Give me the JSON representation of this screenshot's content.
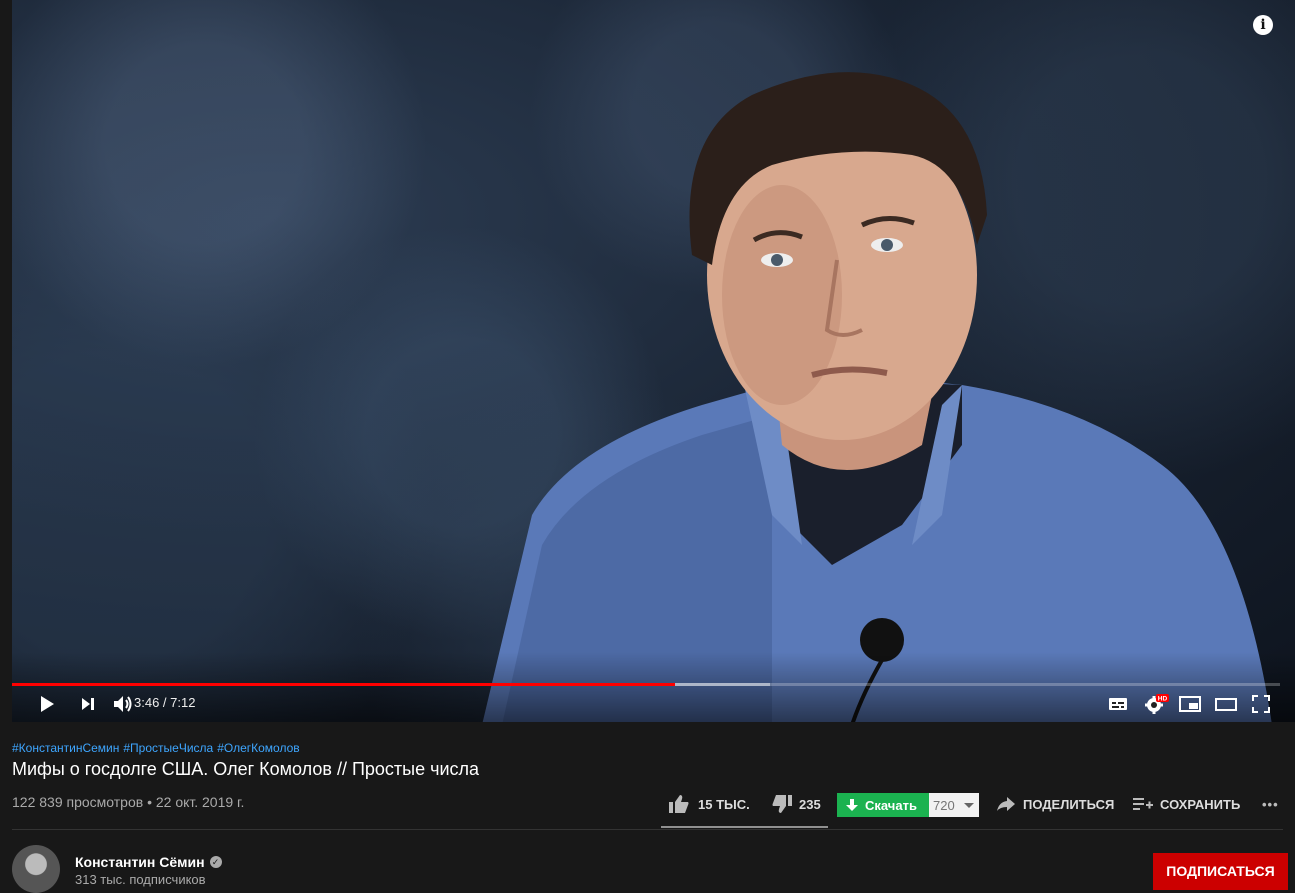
{
  "player": {
    "current_time": "3:46",
    "duration": "7:12",
    "time_display": "3:46 / 7:12",
    "progress_played_fraction": 0.523,
    "progress_buffered_fraction": 0.598,
    "hd_badge": "HD"
  },
  "video": {
    "hashtags": [
      "#КонстантинСемин",
      "#ПростыеЧисла",
      "#ОлегКомолов"
    ],
    "title": "Мифы о госдолге США. Олег Комолов // Простые числа",
    "meta": "122 839 просмотров • 22 окт. 2019 г."
  },
  "actions": {
    "likes": "15 ТЫС.",
    "dislikes": "235",
    "like_fraction": 0.985,
    "download_label": "Скачать",
    "download_quality": "720",
    "share_label": "ПОДЕЛИТЬСЯ",
    "save_label": "СОХРАНИТЬ",
    "more_label": "•••"
  },
  "channel": {
    "name": "Константин Сёмин",
    "subscribers": "313 тыс. подписчиков",
    "subscribe_label": "ПОДПИСАТЬСЯ"
  },
  "colors": {
    "progress": "#ff0000",
    "subscribe": "#cc0000",
    "download": "#1bb250",
    "hashtag": "#3ea6ff"
  }
}
